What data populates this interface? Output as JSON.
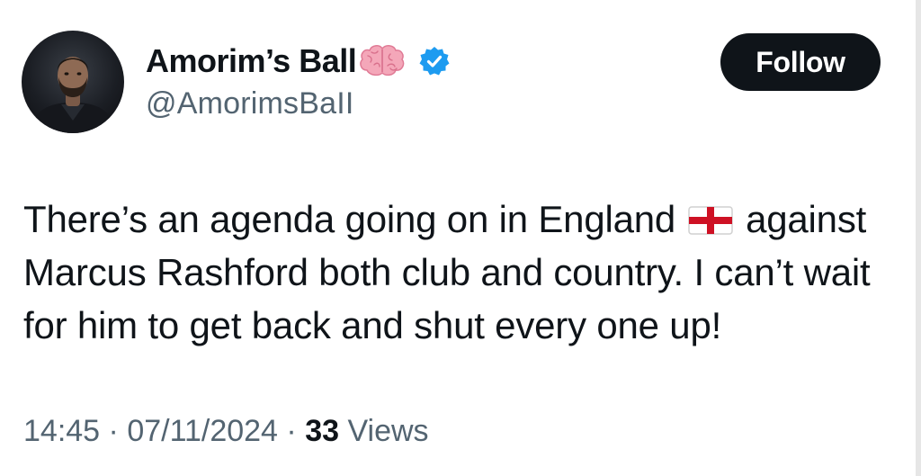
{
  "author": {
    "display_name": "Amorim’s Ball",
    "handle": "@AmorimsBaII",
    "name_emoji": "brain-icon",
    "verified": true,
    "verified_color": "#1d9bf0"
  },
  "follow_button": {
    "label": "Follow"
  },
  "tweet": {
    "text_before_flag": "There’s an agenda going on in England",
    "flag_emoji": "england-flag-icon",
    "text_after_flag": "against Marcus Rashford both club and country. I can’t wait for him to get back and shut every one up!"
  },
  "meta": {
    "time": "14:45",
    "separator_1": " · ",
    "date": "07/11/2024",
    "separator_2": " · ",
    "views_count": "33",
    "views_label": " Views"
  },
  "colors": {
    "text": "#0f1419",
    "secondary_text": "#536471",
    "button_bg": "#0f1419",
    "button_text": "#ffffff"
  }
}
